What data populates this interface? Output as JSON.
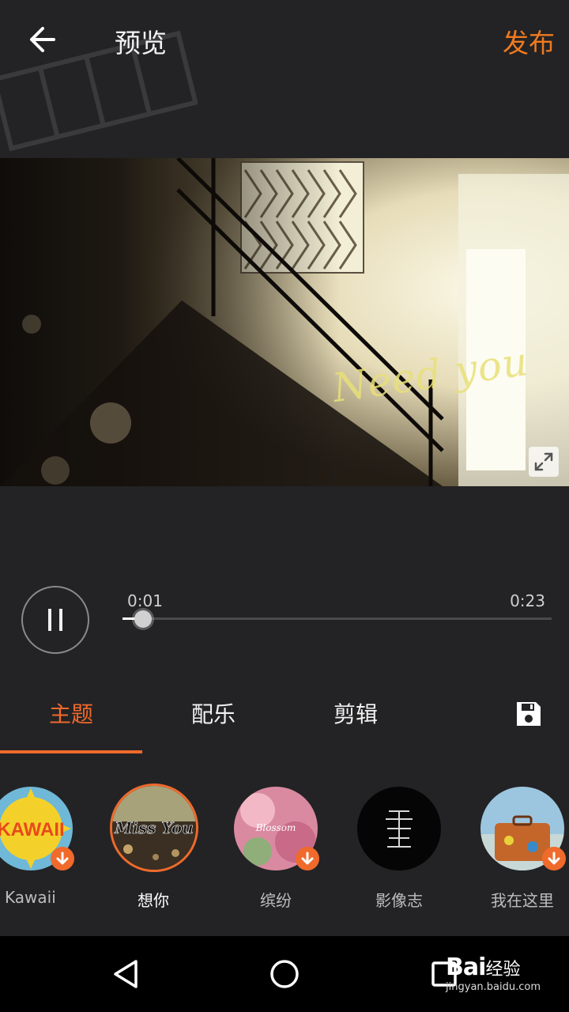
{
  "header": {
    "title": "预览",
    "publish_label": "发布"
  },
  "video": {
    "caption": "Need you"
  },
  "player": {
    "current_time": "0:01",
    "total_time": "0:23",
    "progress_fraction": 0.047,
    "state": "playing"
  },
  "tabs": [
    {
      "label": "主题",
      "active": true
    },
    {
      "label": "配乐",
      "active": false
    },
    {
      "label": "剪辑",
      "active": false
    }
  ],
  "themes": [
    {
      "label": "Kawaii",
      "badge": "download",
      "selected": false,
      "cover_text": "KAWAII"
    },
    {
      "label": "想你",
      "badge": "",
      "selected": true,
      "cover_text": "Miss You"
    },
    {
      "label": "缤纷",
      "badge": "download",
      "selected": false,
      "cover_text": "Blossom"
    },
    {
      "label": "影像志",
      "badge": "",
      "selected": false,
      "cover_text": ""
    },
    {
      "label": "我在这里",
      "badge": "download",
      "selected": false,
      "cover_text": ""
    }
  ],
  "watermark": {
    "brand": "Bai",
    "suffix": "经验",
    "url": "jingyan.baidu.com"
  },
  "colors": {
    "accent": "#f06a2c",
    "publish": "#f07a20",
    "background": "#232325",
    "navbar": "#000000"
  },
  "icons": [
    "back-arrow-icon",
    "fullscreen-icon",
    "pause-icon",
    "save-icon",
    "download-icon",
    "nav-back-icon",
    "nav-home-icon",
    "nav-recents-icon"
  ]
}
